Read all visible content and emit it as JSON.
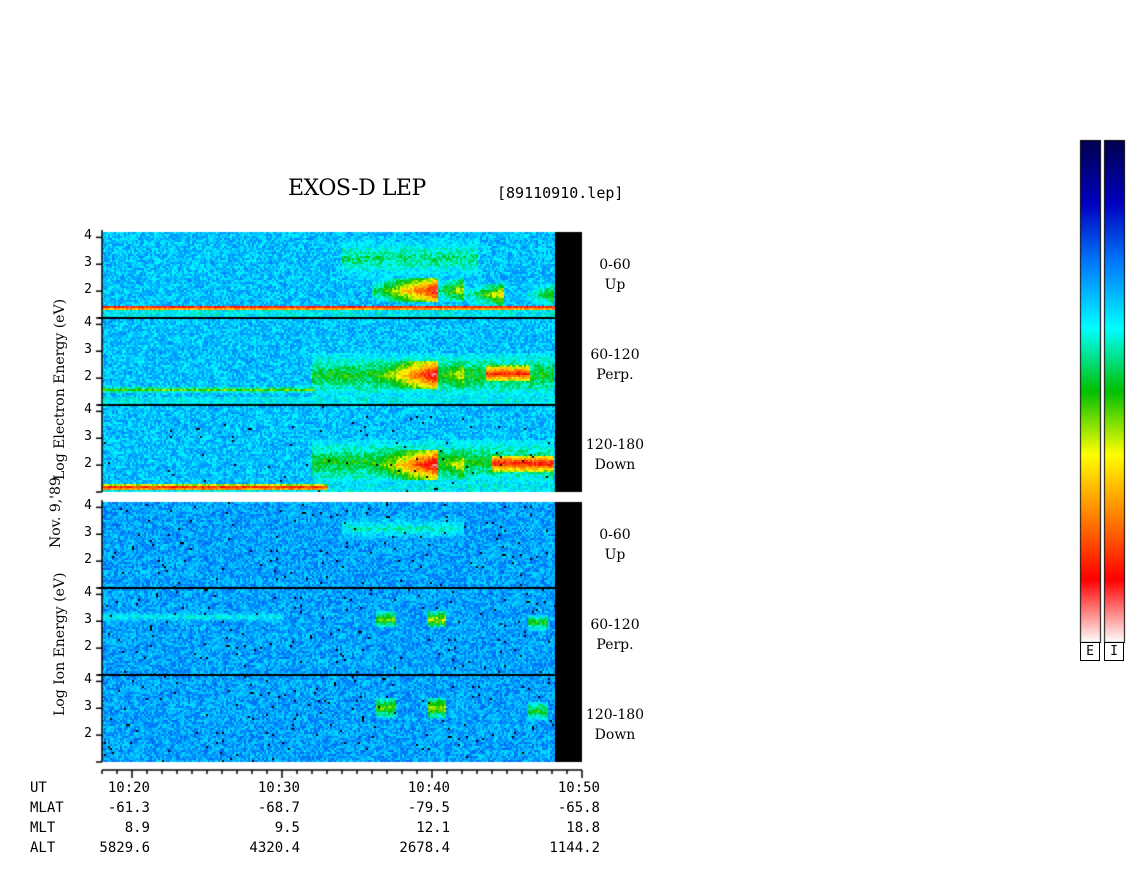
{
  "title": "EXOS-D LEP",
  "filename": "[89110910.lep]",
  "y_axis_labels": {
    "date": "Nov. 9,'89",
    "electron": "Log  Electron  Energy  (eV)",
    "ion": "Log  Ion  Energy  (eV)"
  },
  "channels": [
    {
      "range": "0-60",
      "dir": "Up"
    },
    {
      "range": "60-120",
      "dir": "Perp."
    },
    {
      "range": "120-180",
      "dir": "Down"
    },
    {
      "range": "0-60",
      "dir": "Up"
    },
    {
      "range": "60-120",
      "dir": "Perp."
    },
    {
      "range": "120-180",
      "dir": "Down"
    }
  ],
  "colorbar_labels": [
    "E",
    "I"
  ],
  "ephemeris": {
    "names": [
      "UT",
      "MLAT",
      "MLT",
      "ALT"
    ],
    "rows": [
      [
        "10:20",
        "10:30",
        "10:40",
        "10:50"
      ],
      [
        "-61.3",
        "-68.7",
        "-79.5",
        "-65.8"
      ],
      [
        "8.9",
        "9.5",
        "12.1",
        "18.8"
      ],
      [
        "5829.6",
        "4320.4",
        "2678.4",
        "1144.2"
      ]
    ]
  },
  "chart_data": {
    "type": "heatmap",
    "xlabel": "UT",
    "x_ticks": [
      "10:20",
      "10:30",
      "10:40",
      "10:50"
    ],
    "x_range_min": [
      18,
      50
    ],
    "data_end_min": 48.2,
    "y_ticks": [
      "2",
      "3",
      "4"
    ],
    "ylim_log_eV": [
      1.0,
      4.2
    ],
    "colormap": [
      "#ffffff",
      "#ff0000",
      "#ff8000",
      "#ffff00",
      "#00c000",
      "#00ffff",
      "#0080ff",
      "#0000c0",
      "#000050"
    ],
    "panels": [
      {
        "species": "Electron",
        "pitch": "0-60",
        "direction": "Up",
        "features": [
          {
            "kind": "band",
            "t": [
              18,
              48.2
            ],
            "logE": [
              1.35,
              1.5
            ],
            "level": 0.95
          },
          {
            "kind": "patch",
            "t": [
              36,
              42
            ],
            "logE": [
              1.6,
              2.5
            ],
            "level": 0.9,
            "spiky": true
          },
          {
            "kind": "patch",
            "t": [
              42,
              48
            ],
            "logE": [
              1.5,
              2.3
            ],
            "level": 0.65,
            "spiky": true
          },
          {
            "kind": "patch",
            "t": [
              34,
              43
            ],
            "logE": [
              2.5,
              4.0
            ],
            "level": 0.45
          }
        ]
      },
      {
        "species": "Electron",
        "pitch": "60-120",
        "direction": "Perp.",
        "features": [
          {
            "kind": "band",
            "t": [
              18,
              32
            ],
            "logE": [
              1.5,
              1.7
            ],
            "level": 0.55
          },
          {
            "kind": "patch",
            "t": [
              36,
              42
            ],
            "logE": [
              1.6,
              2.7
            ],
            "level": 0.92,
            "spiky": true
          },
          {
            "kind": "patch",
            "t": [
              43.5,
              46.5
            ],
            "logE": [
              1.9,
              2.5
            ],
            "level": 0.85
          },
          {
            "kind": "patch",
            "t": [
              32,
              48
            ],
            "logE": [
              1.3,
              3.0
            ],
            "level": 0.5
          }
        ]
      },
      {
        "species": "Electron",
        "pitch": "120-180",
        "direction": "Down",
        "features": [
          {
            "kind": "band",
            "t": [
              18,
              33
            ],
            "logE": [
              1.1,
              1.3
            ],
            "level": 0.9
          },
          {
            "kind": "patch",
            "t": [
              36,
              42
            ],
            "logE": [
              1.5,
              2.6
            ],
            "level": 0.93,
            "spiky": true
          },
          {
            "kind": "patch",
            "t": [
              44,
              48
            ],
            "logE": [
              1.8,
              2.4
            ],
            "level": 0.88
          },
          {
            "kind": "patch",
            "t": [
              32,
              48
            ],
            "logE": [
              1.3,
              3.0
            ],
            "level": 0.5
          }
        ]
      },
      {
        "species": "Ion",
        "pitch": "0-60",
        "direction": "Up",
        "features": [
          {
            "kind": "patch",
            "t": [
              34,
              42
            ],
            "logE": [
              2.8,
              3.7
            ],
            "level": 0.4
          }
        ]
      },
      {
        "species": "Ion",
        "pitch": "60-120",
        "direction": "Perp.",
        "features": [
          {
            "kind": "band",
            "t": [
              18,
              30
            ],
            "logE": [
              3.0,
              3.4
            ],
            "level": 0.38
          },
          {
            "kind": "patch",
            "t": [
              36.2,
              37.5
            ],
            "logE": [
              2.8,
              3.4
            ],
            "level": 0.55
          },
          {
            "kind": "patch",
            "t": [
              39.7,
              40.8
            ],
            "logE": [
              2.8,
              3.4
            ],
            "level": 0.6
          },
          {
            "kind": "patch",
            "t": [
              46.3,
              47.7
            ],
            "logE": [
              2.7,
              3.3
            ],
            "level": 0.5
          }
        ]
      },
      {
        "species": "Ion",
        "pitch": "120-180",
        "direction": "Down",
        "features": [
          {
            "kind": "patch",
            "t": [
              36.2,
              37.5
            ],
            "logE": [
              2.7,
              3.4
            ],
            "level": 0.55
          },
          {
            "kind": "patch",
            "t": [
              39.7,
              40.8
            ],
            "logE": [
              2.7,
              3.4
            ],
            "level": 0.6
          },
          {
            "kind": "patch",
            "t": [
              46.3,
              47.7
            ],
            "logE": [
              2.6,
              3.3
            ],
            "level": 0.5
          }
        ]
      }
    ]
  }
}
